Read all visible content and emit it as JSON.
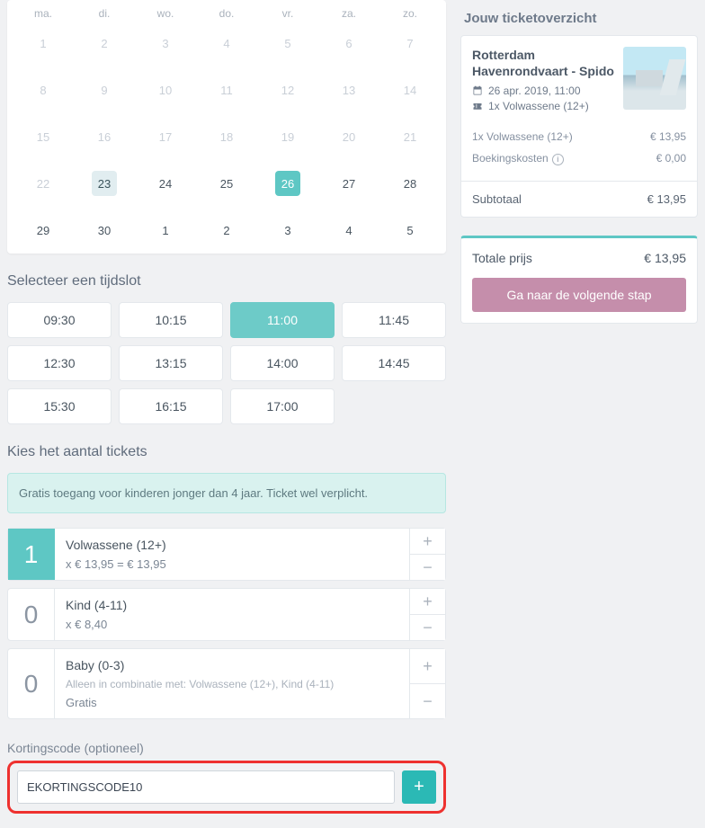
{
  "calendar": {
    "weekdays": [
      "ma.",
      "di.",
      "wo.",
      "do.",
      "vr.",
      "za.",
      "zo."
    ],
    "days": [
      {
        "n": "1",
        "state": "muted"
      },
      {
        "n": "2",
        "state": "muted"
      },
      {
        "n": "3",
        "state": "muted"
      },
      {
        "n": "4",
        "state": "muted"
      },
      {
        "n": "5",
        "state": "muted"
      },
      {
        "n": "6",
        "state": "muted"
      },
      {
        "n": "7",
        "state": "muted"
      },
      {
        "n": "8",
        "state": "muted"
      },
      {
        "n": "9",
        "state": "muted"
      },
      {
        "n": "10",
        "state": "muted"
      },
      {
        "n": "11",
        "state": "muted"
      },
      {
        "n": "12",
        "state": "muted"
      },
      {
        "n": "13",
        "state": "muted"
      },
      {
        "n": "14",
        "state": "muted"
      },
      {
        "n": "15",
        "state": "muted"
      },
      {
        "n": "16",
        "state": "muted"
      },
      {
        "n": "17",
        "state": "muted"
      },
      {
        "n": "18",
        "state": "muted"
      },
      {
        "n": "19",
        "state": "muted"
      },
      {
        "n": "20",
        "state": "muted"
      },
      {
        "n": "21",
        "state": "muted"
      },
      {
        "n": "22",
        "state": "muted"
      },
      {
        "n": "23",
        "state": "today"
      },
      {
        "n": "24",
        "state": ""
      },
      {
        "n": "25",
        "state": ""
      },
      {
        "n": "26",
        "state": "selected"
      },
      {
        "n": "27",
        "state": ""
      },
      {
        "n": "28",
        "state": ""
      },
      {
        "n": "29",
        "state": ""
      },
      {
        "n": "30",
        "state": ""
      },
      {
        "n": "1",
        "state": ""
      },
      {
        "n": "2",
        "state": ""
      },
      {
        "n": "3",
        "state": ""
      },
      {
        "n": "4",
        "state": ""
      },
      {
        "n": "5",
        "state": ""
      }
    ]
  },
  "sections": {
    "timeslot_heading": "Selecteer een tijdslot",
    "tickets_heading": "Kies het aantal tickets"
  },
  "timeslots": [
    {
      "label": "09:30",
      "selected": false
    },
    {
      "label": "10:15",
      "selected": false
    },
    {
      "label": "11:00",
      "selected": true
    },
    {
      "label": "11:45",
      "selected": false
    },
    {
      "label": "12:30",
      "selected": false
    },
    {
      "label": "13:15",
      "selected": false
    },
    {
      "label": "14:00",
      "selected": false
    },
    {
      "label": "14:45",
      "selected": false
    },
    {
      "label": "15:30",
      "selected": false
    },
    {
      "label": "16:15",
      "selected": false
    },
    {
      "label": "17:00",
      "selected": false
    }
  ],
  "banner": "Gratis toegang voor kinderen jonger dan 4 jaar. Ticket wel verplicht.",
  "tickets": [
    {
      "qty": "1",
      "active": true,
      "name": "Volwassene (12+)",
      "sub": "",
      "price": "x € 13,95 = € 13,95"
    },
    {
      "qty": "0",
      "active": false,
      "name": "Kind (4-11)",
      "sub": "",
      "price": "x € 8,40"
    },
    {
      "qty": "0",
      "active": false,
      "name": "Baby (0-3)",
      "sub": "Alleen in combinatie met: Volwassene (12+), Kind (4-11)",
      "price": "Gratis"
    }
  ],
  "coupon": {
    "label": "Kortingscode (optioneel)",
    "value": "EKORTINGSCODE10"
  },
  "summary": {
    "heading": "Jouw ticketoverzicht",
    "title": "Rotterdam Havenrondvaart - Spido",
    "date": "26 apr. 2019, 11:00",
    "pax": "1x Volwassene (12+)",
    "lines": [
      {
        "label": "1x Volwassene (12+)",
        "value": "€ 13,95"
      },
      {
        "label": "Boekingskosten",
        "value": "€ 0,00",
        "info": true
      }
    ],
    "subtotal_label": "Subtotaal",
    "subtotal_value": "€ 13,95",
    "total_label": "Totale prijs",
    "total_value": "€ 13,95",
    "next_label": "Ga naar de volgende stap"
  }
}
